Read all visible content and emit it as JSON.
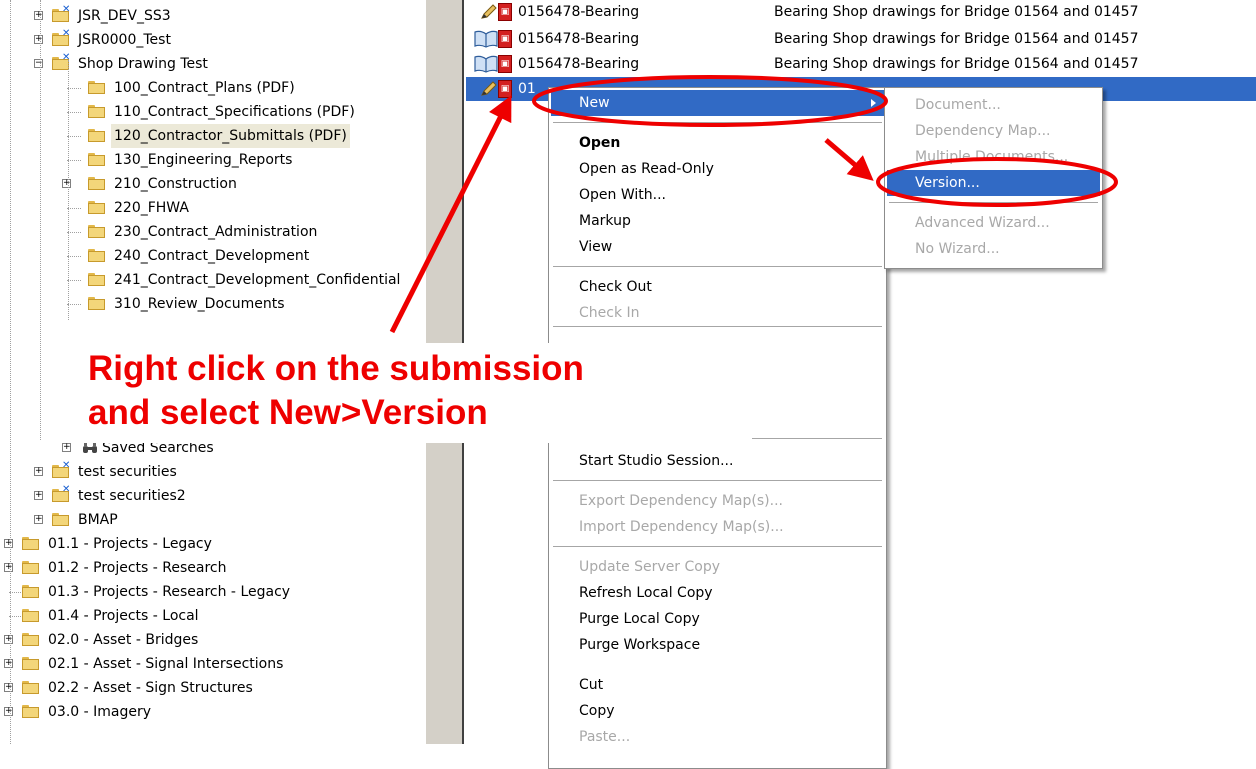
{
  "tree": {
    "items": [
      {
        "label": "JSR_DEV_SS3",
        "expander": "+",
        "icon": "security-folder-icon"
      },
      {
        "label": "JSR0000_Test",
        "expander": "+",
        "icon": "security-folder-icon"
      },
      {
        "label": "Shop Drawing Test",
        "expander": "−",
        "icon": "security-folder-icon"
      },
      {
        "label": "100_Contract_Plans (PDF)",
        "expander": "",
        "icon": "folder-icon"
      },
      {
        "label": "110_Contract_Specifications (PDF)",
        "expander": "",
        "icon": "folder-icon"
      },
      {
        "label": "120_Contractor_Submittals (PDF)",
        "expander": "",
        "icon": "folder-icon",
        "selected": true
      },
      {
        "label": "130_Engineering_Reports",
        "expander": "",
        "icon": "folder-icon"
      },
      {
        "label": "210_Construction",
        "expander": "+",
        "icon": "folder-icon"
      },
      {
        "label": "220_FHWA",
        "expander": "",
        "icon": "folder-icon"
      },
      {
        "label": "230_Contract_Administration",
        "expander": "",
        "icon": "folder-icon"
      },
      {
        "label": "240_Contract_Development",
        "expander": "",
        "icon": "folder-icon"
      },
      {
        "label": "241_Contract_Development_Confidential",
        "expander": "",
        "icon": "folder-icon"
      },
      {
        "label": "310_Review_Documents",
        "expander": "",
        "icon": "folder-icon"
      },
      {
        "label": "Saved Searches",
        "expander": "+",
        "icon": "binoculars-icon"
      },
      {
        "label": "test securities",
        "expander": "+",
        "icon": "security-folder-icon"
      },
      {
        "label": "test securities2",
        "expander": "+",
        "icon": "security-folder-icon"
      },
      {
        "label": "BMAP",
        "expander": "+",
        "icon": "folder-icon"
      },
      {
        "label": "01.1 - Projects - Legacy",
        "expander": "+",
        "icon": "folder-icon"
      },
      {
        "label": "01.2 - Projects - Research",
        "expander": "+",
        "icon": "folder-icon"
      },
      {
        "label": "01.3 - Projects - Research - Legacy",
        "expander": "",
        "icon": "folder-icon"
      },
      {
        "label": "01.4 - Projects - Local",
        "expander": "",
        "icon": "folder-icon"
      },
      {
        "label": "02.0 - Asset - Bridges",
        "expander": "+",
        "icon": "folder-icon"
      },
      {
        "label": "02.1 - Asset - Signal Intersections",
        "expander": "+",
        "icon": "folder-icon"
      },
      {
        "label": "02.2 - Asset - Sign Structures",
        "expander": "+",
        "icon": "folder-icon"
      },
      {
        "label": "03.0 - Imagery",
        "expander": "+",
        "icon": "folder-icon"
      }
    ]
  },
  "documents": [
    {
      "name": "0156478-Bearing",
      "description": "Bearing Shop drawings for Bridge 01564 and 01457",
      "status_icon": "pencil-icon"
    },
    {
      "name": "0156478-Bearing",
      "description": "Bearing Shop drawings for Bridge 01564 and 01457",
      "status_icon": "book-icon"
    },
    {
      "name": "0156478-Bearing",
      "description": "Bearing Shop drawings for Bridge 01564 and 01457",
      "status_icon": "book-icon"
    },
    {
      "name": "01",
      "description": "",
      "status_icon": "pencil-icon",
      "selected": true
    }
  ],
  "context_menu": {
    "groups": [
      [
        {
          "label": "New",
          "submenu": true,
          "highlighted": true
        }
      ],
      [
        {
          "label": "Open",
          "bold": true
        },
        {
          "label": "Open as Read-Only"
        },
        {
          "label": "Open With..."
        },
        {
          "label": "Markup"
        },
        {
          "label": "View"
        }
      ],
      [
        {
          "label": "Check Out"
        },
        {
          "label": "Check In",
          "disabled": true
        }
      ],
      [
        {
          "label": "Start Studio Session..."
        }
      ],
      [
        {
          "label": "Export Dependency Map(s)...",
          "disabled": true
        },
        {
          "label": "Import Dependency Map(s)...",
          "disabled": true
        }
      ],
      [
        {
          "label": "Update Server Copy",
          "disabled": true
        },
        {
          "label": "Refresh Local Copy"
        },
        {
          "label": "Purge Local Copy"
        },
        {
          "label": "Purge Workspace"
        }
      ],
      [
        {
          "label": "Cut"
        },
        {
          "label": "Copy"
        },
        {
          "label": "Paste...",
          "disabled": true
        }
      ]
    ]
  },
  "submenu": {
    "groups": [
      [
        {
          "label": "Document...",
          "disabled": true
        },
        {
          "label": "Dependency Map...",
          "disabled": true
        },
        {
          "label": "Multiple Documents...",
          "disabled": true
        },
        {
          "label": "Version...",
          "highlighted": true
        }
      ],
      [
        {
          "label": "Advanced Wizard...",
          "disabled": true
        },
        {
          "label": "No Wizard...",
          "disabled": true
        }
      ]
    ]
  },
  "annotation": {
    "line1": "Right click on the submission",
    "line2": "and select New>Version",
    "color": "#ee0000"
  },
  "colors": {
    "selection": "#316ac5",
    "tree_selection": "#ece9d8",
    "splitter": "#d4d0c8"
  }
}
